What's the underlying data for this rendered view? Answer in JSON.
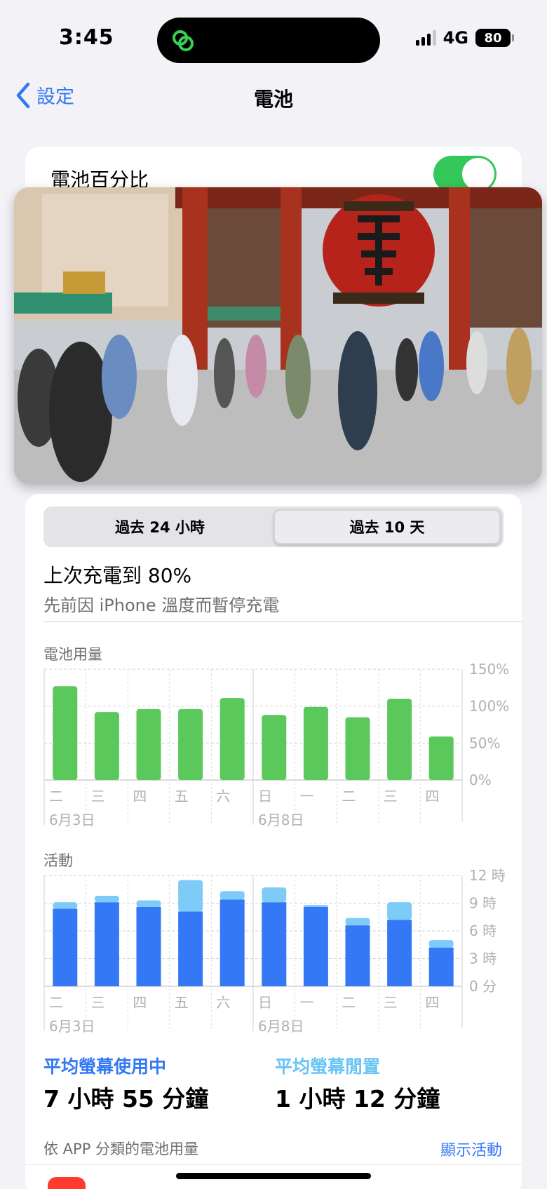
{
  "status": {
    "time": "3:45",
    "network": "4G",
    "battery_level": "80"
  },
  "nav": {
    "back_label": "設定",
    "title": "電池"
  },
  "battery_percentage": {
    "label": "電池百分比",
    "enabled": true
  },
  "segmented": {
    "options": [
      "過去 24 小時",
      "過去 10 天"
    ],
    "selected_index": 1
  },
  "charge": {
    "title": "上次充電到 80%",
    "subtitle": "先前因 iPhone 溫度而暫停充電"
  },
  "colors": {
    "accent": "#3478f6",
    "battery_bar": "#5ac85a",
    "screen_on": "#3478f6",
    "screen_off": "#7fcbf8"
  },
  "chart_data": [
    {
      "type": "bar",
      "title": "電池用量",
      "categories": [
        "二",
        "三",
        "四",
        "五",
        "六",
        "日",
        "一",
        "二",
        "三",
        "四"
      ],
      "date_labels": [
        "6月3日",
        "6月8日"
      ],
      "y_ticks": [
        "150%",
        "100%",
        "50%",
        "0%"
      ],
      "ylim": [
        0,
        150
      ],
      "series": [
        {
          "values": [
            127,
            92,
            96,
            96,
            111,
            88,
            99,
            85,
            110,
            59
          ]
        }
      ]
    },
    {
      "type": "bar",
      "title": "活動",
      "stacked": true,
      "categories": [
        "二",
        "三",
        "四",
        "五",
        "六",
        "日",
        "一",
        "二",
        "三",
        "四"
      ],
      "date_labels": [
        "6月3日",
        "6月8日"
      ],
      "y_ticks": [
        "12 時",
        "9 時",
        "6 時",
        "3 時",
        "0 分"
      ],
      "ylim": [
        0,
        12
      ],
      "series": [
        {
          "name": "平均螢幕使用中",
          "values": [
            8.4,
            9.1,
            8.6,
            8.1,
            9.4,
            9.1,
            8.6,
            6.6,
            7.2,
            4.2
          ]
        },
        {
          "name": "平均螢幕閒置",
          "values": [
            0.7,
            0.7,
            0.7,
            3.4,
            0.9,
            1.6,
            0.2,
            0.8,
            1.9,
            0.8
          ]
        }
      ]
    }
  ],
  "averages": {
    "screen_on_label": "平均螢幕使用中",
    "screen_on_value": "7 小時 55 分鐘",
    "screen_off_label": "平均螢幕閒置",
    "screen_off_value": "1 小時 12 分鐘"
  },
  "app_section": {
    "title": "依 APP 分類的電池用量",
    "action": "顯示活動"
  }
}
